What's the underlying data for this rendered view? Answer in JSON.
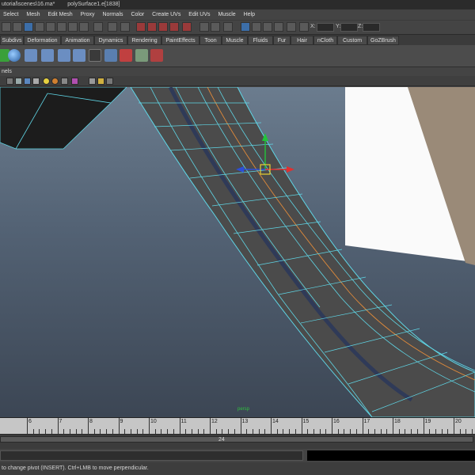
{
  "title": {
    "path": "utorial\\scenes\\16.ma*",
    "object": "polySurface1.e[1838]"
  },
  "menu": [
    "Select",
    "Mesh",
    "Edit Mesh",
    "Proxy",
    "Normals",
    "Color",
    "Create UVs",
    "Edit UVs",
    "Muscle",
    "Help"
  ],
  "status_line": {
    "x_label": "X:",
    "y_label": "Y:",
    "z_label": "Z:",
    "x_value": "",
    "y_value": "",
    "z_value": ""
  },
  "shelf_tabs": [
    "Subdivs",
    "Deformation",
    "Animation",
    "Dynamics",
    "Rendering",
    "PaintEffects",
    "Toon",
    "Muscle",
    "Fluids",
    "Fur",
    "Hair",
    "nCloth",
    "Custom",
    "GoZBrush"
  ],
  "panel_menu": "nels",
  "viewport": {
    "camera_label": "persp"
  },
  "time_slider": {
    "ticks": [
      "6",
      "7",
      "8",
      "9",
      "10",
      "11",
      "12",
      "13",
      "14",
      "15",
      "16",
      "17",
      "18",
      "19",
      "20"
    ]
  },
  "range_slider": {
    "end_frame": "24"
  },
  "help_line": "to change pivot (INSERT).  Ctrl+LMB to move perpendicular.",
  "colors": {
    "mesh_face": "#4a4a4a",
    "wire": "#5fd6e6",
    "edge_loop": "#e08a3a",
    "manip_y": "#22c33a",
    "manip_x": "#e03030",
    "manip_z": "#2c4fd8",
    "manip_center": "#e8d030"
  },
  "icons": {
    "move_manipulator": "move-manipulator-icon"
  }
}
